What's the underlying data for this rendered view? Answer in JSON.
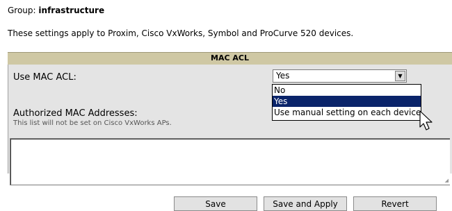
{
  "group": {
    "label": "Group:",
    "value": "infrastructure"
  },
  "description": "These settings apply to Proxim, Cisco VxWorks, Symbol and ProCurve 520 devices.",
  "mac_acl": {
    "header": "MAC ACL",
    "use_label": "Use MAC ACL:",
    "use_value": "Yes",
    "options": [
      "No",
      "Yes",
      "Use manual setting on each device"
    ],
    "selected_option": "Yes",
    "authorized_label": "Authorized MAC Addresses:",
    "authorized_note": "This list will not be set on Cisco VxWorks APs.",
    "authorized_value": ""
  },
  "buttons": {
    "save": "Save",
    "save_apply": "Save and Apply",
    "revert": "Revert"
  },
  "icons": {
    "dropdown_arrow": "chevron-down-icon",
    "cursor": "mouse-pointer-icon",
    "resize": "resize-grip-icon"
  },
  "colors": {
    "header_bg": "#cfc8a4",
    "body_bg": "#e4e4e4",
    "selected_bg": "#0a246a"
  }
}
